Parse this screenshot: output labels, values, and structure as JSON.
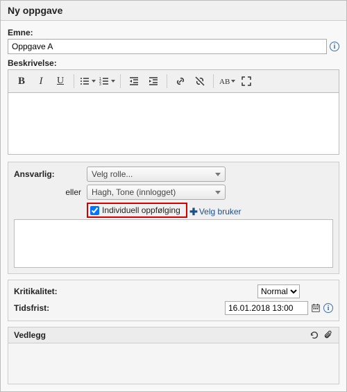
{
  "header": {
    "title": "Ny oppgave"
  },
  "subject": {
    "label": "Emne:",
    "value": "Oppgave A"
  },
  "description": {
    "label": "Beskrivelse:"
  },
  "responsible": {
    "label": "Ansvarlig:",
    "role_placeholder": "Velg rolle...",
    "or": "eller",
    "user_selected": "Hagh, Tone (innlogget)",
    "individual_label": "Individuell oppfølging",
    "pick_user": "Velg bruker"
  },
  "criticality": {
    "label": "Kritikalitet:",
    "value": "Normal"
  },
  "deadline": {
    "label": "Tidsfrist:",
    "value": "16.01.2018 13:00"
  },
  "attachments": {
    "label": "Vedlegg"
  }
}
